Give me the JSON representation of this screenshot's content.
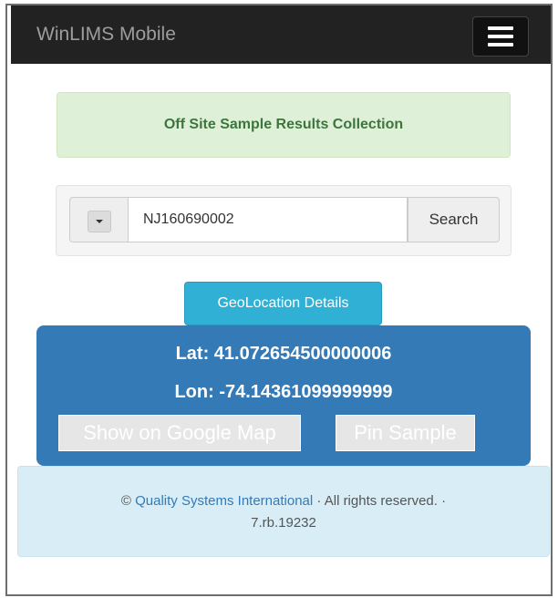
{
  "navbar": {
    "brand": "WinLIMS Mobile",
    "menu_icon": "hamburger-menu-icon"
  },
  "alert": {
    "text": "Off Site Sample Results Collection",
    "color": "#3c763d"
  },
  "search": {
    "dropdown_icon": "caret-down-icon",
    "value": "NJ160690002",
    "button_label": "Search"
  },
  "geolocation": {
    "button_label": "GeoLocation Details",
    "lat": "Lat: 41.072654500000006",
    "lon": "Lon: -74.14361099999999",
    "map_button_label": "Show on Google Map",
    "pin_button_label": "Pin Sample",
    "panel_color": "#337ab7"
  },
  "footer": {
    "copyright_symbol": "©",
    "company_link": "Quality Systems International",
    "rights": "· All rights reserved. ·",
    "version": "7.rb.19232"
  },
  "colors": {
    "navbar": "#222222",
    "info_button": "#31b0d5",
    "footer_bg": "#d9edf7"
  }
}
